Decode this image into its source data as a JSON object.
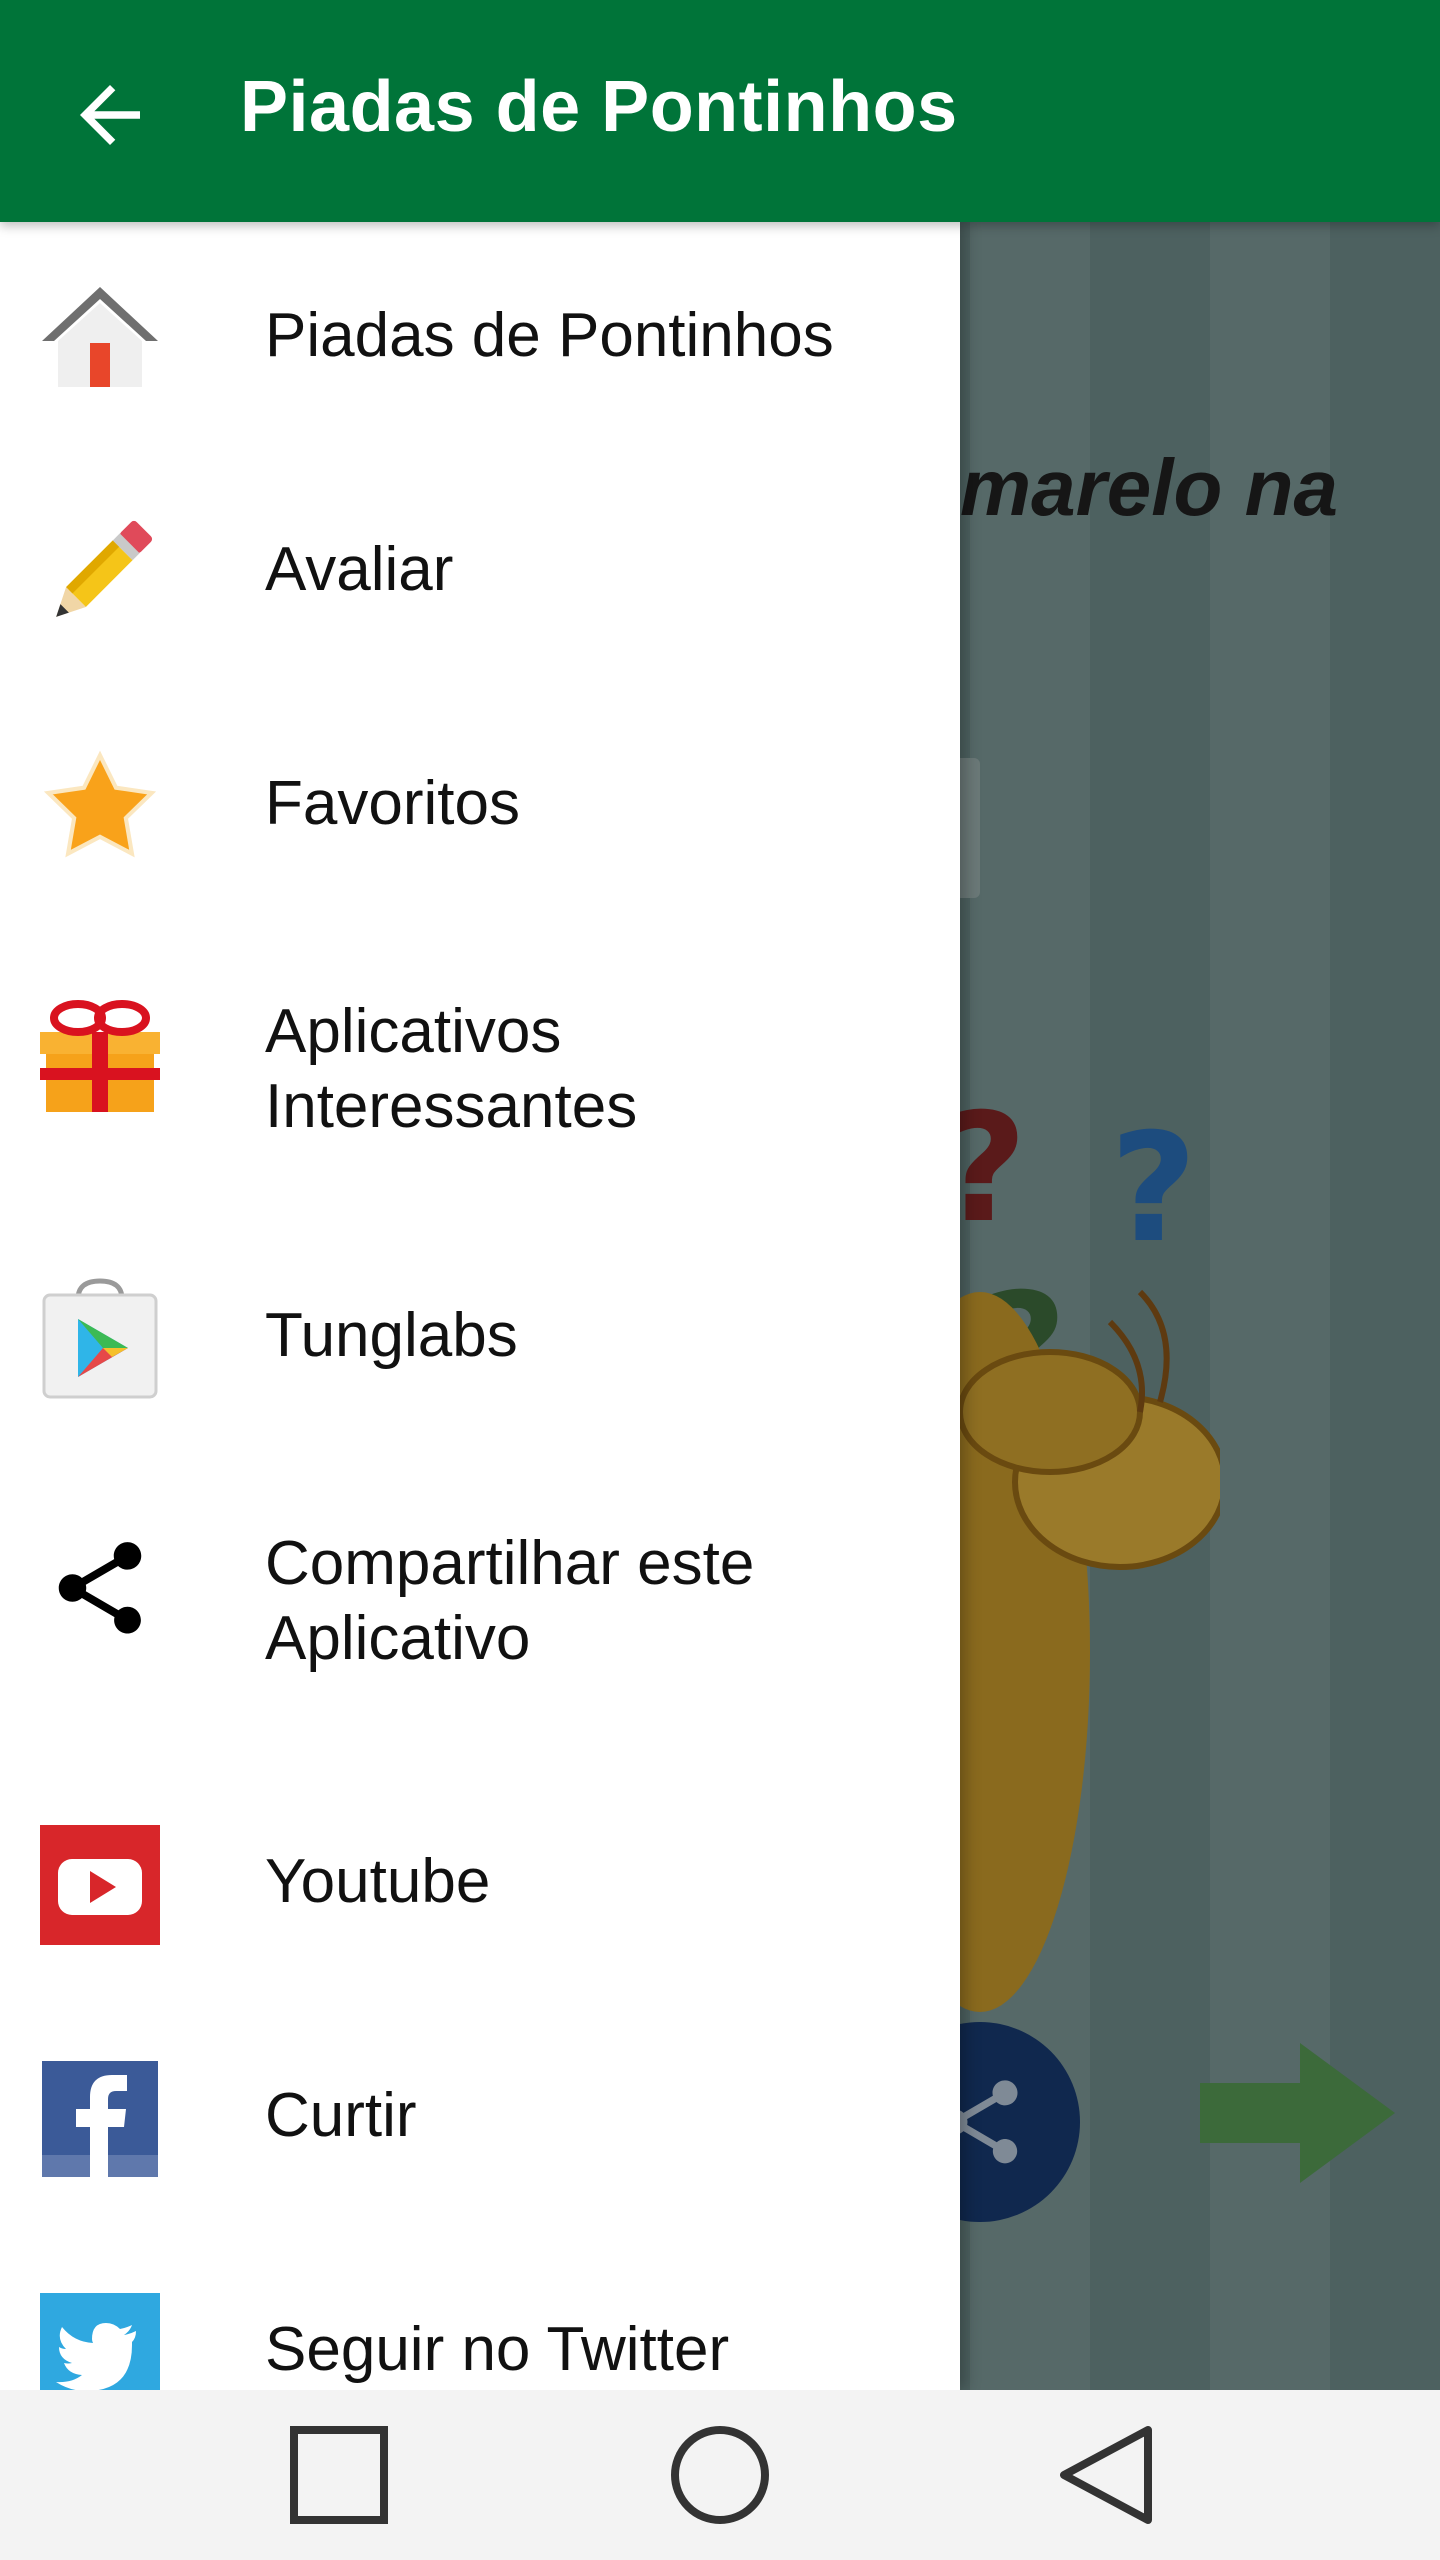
{
  "appbar": {
    "title": "Piadas de Pontinhos",
    "back_icon": "arrow-left-icon",
    "color": "#007439"
  },
  "background": {
    "visible_text": "marelo na"
  },
  "drawer": {
    "items": [
      {
        "label": "Piadas de Pontinhos",
        "icon": "home-icon"
      },
      {
        "label": "Avaliar",
        "icon": "pencil-icon"
      },
      {
        "label": "Favoritos",
        "icon": "star-icon"
      },
      {
        "label": "Aplicativos Interessantes",
        "label_lines": [
          "Aplicativos",
          "Interessantes"
        ],
        "icon": "gift-icon"
      },
      {
        "label": "Tunglabs",
        "icon": "play-store-icon"
      },
      {
        "label": "Compartilhar este Aplicativo",
        "label_lines": [
          "Compartilhar este",
          "Aplicativo"
        ],
        "icon": "share-icon"
      },
      {
        "label": "Youtube",
        "icon": "youtube-icon"
      },
      {
        "label": "Curtir",
        "icon": "facebook-icon"
      },
      {
        "label": "Seguir no Twitter",
        "icon": "twitter-icon"
      }
    ]
  },
  "navbar": {
    "buttons": [
      "recents-icon",
      "home-circle-icon",
      "back-triangle-icon"
    ]
  }
}
